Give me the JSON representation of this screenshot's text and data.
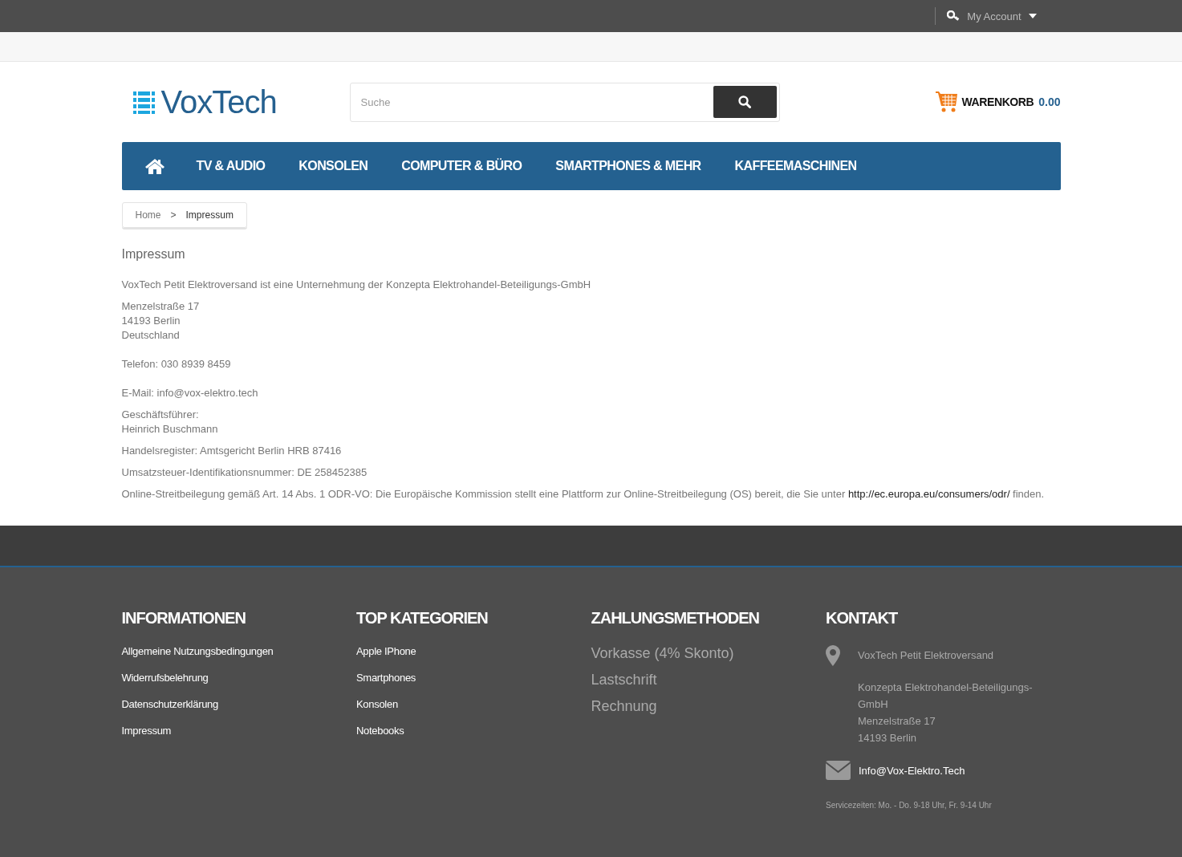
{
  "topbar": {
    "account": "My Account"
  },
  "header": {
    "logo": "VoxTech",
    "search": {
      "placeholder": "Suche"
    },
    "cart": {
      "label": "WARENKORB",
      "amount": "0.00"
    }
  },
  "nav": {
    "items": [
      "TV & AUDIO",
      "KONSOLEN",
      "COMPUTER & BÜRO",
      "SMARTPHONES & MEHR",
      "KAFFEEMASCHINEN"
    ]
  },
  "breadcrumb": [
    {
      "label": "Home",
      "selected": false
    },
    {
      "label": "Impressum",
      "selected": true
    }
  ],
  "breadcrumb_separator": ">",
  "page": {
    "title": "Impressum",
    "blocks": [
      {
        "lines": [
          "VoxTech Petit Elektroversand ist eine Unternehmung der Konzepta Elektrohandel-Beteiligungs-GmbH"
        ]
      },
      {
        "lines": [
          "Menzelstraße 17",
          "14193 Berlin",
          "Deutschland"
        ]
      },
      {
        "lines": [
          "Telefon: 030 8939 8459"
        ]
      },
      {
        "lines": [
          "E-Mail: info@vox-elektro.tech"
        ]
      },
      {
        "lines": [
          "Geschäftsführer:",
          "Heinrich Buschmann"
        ]
      },
      {
        "lines": [
          "Handelsregister: Amtsgericht Berlin HRB 87416"
        ]
      },
      {
        "lines": [
          "Umsatzsteuer-Identifikationsnummer: DE 258452385"
        ]
      }
    ],
    "odr": {
      "before": "Online-Streitbeilegung gemäß Art. 14 Abs. 1 ODR-VO: Die Europäische Kommission stellt eine Plattform zur Online-Streitbeilegung (OS) bereit, die Sie unter",
      "link": "http://ec.europa.eu/consumers/odr/",
      "after": "finden."
    }
  },
  "footer": {
    "columns": [
      {
        "title": "INFORMATIONEN",
        "kind": "links",
        "items": [
          "Allgemeine Nutzungsbedingungen",
          "Widerrufsbelehrung",
          "Datenschutzerklärung",
          "Impressum"
        ]
      },
      {
        "title": "TOP KATEGORIEN",
        "kind": "links",
        "items": [
          "Apple IPhone",
          "Smartphones",
          "Konsolen",
          "Notebooks"
        ]
      },
      {
        "title": "ZAHLUNGSMETHODEN",
        "kind": "payments",
        "items": [
          "Vorkasse (4% Skonto)",
          "Lastschrift",
          "Rechnung"
        ]
      }
    ],
    "contact": {
      "title": "KONTAKT",
      "company": "VoxTech Petit Elektroversand",
      "address": [
        "Konzepta Elektrohandel-Beteiligungs-GmbH",
        "Menzelstraße 17",
        "14193 Berlin"
      ],
      "email": "Info@Vox-Elektro.Tech",
      "hours": "Servicezeiten: Mo. - Do. 9-18 Uhr, Fr. 9-14 Uhr"
    }
  }
}
